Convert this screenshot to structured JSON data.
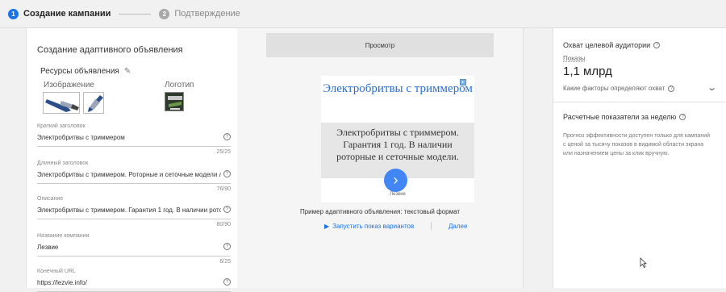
{
  "stepper": {
    "step1_num": "1",
    "step1_label": "Создание кампании",
    "step2_num": "2",
    "step2_label": "Подтверждение"
  },
  "form": {
    "title": "Создание адаптивного объявления",
    "resources_title": "Ресурсы объявления",
    "image_label": "Изображение",
    "logo_label": "Логотип",
    "fields": [
      {
        "label": "Краткий заголовок",
        "value": "Электробритвы с триммером",
        "count": "25/25"
      },
      {
        "label": "Длинный заголовок",
        "value": "Электробритвы с триммером. Роторные и сеточные модели л",
        "count": "76/90"
      },
      {
        "label": "Описание",
        "value": "Электробритвы с триммером. Гарантия 1 год. В наличии ротор",
        "count": "80/90"
      },
      {
        "label": "Название компании",
        "value": "Лезвие",
        "count": "6/25"
      },
      {
        "label": "Конечный URL",
        "value": "https://lezvie.info/",
        "count": ""
      }
    ]
  },
  "preview": {
    "header": "Просмотр",
    "ad_title": "Электробритвы с триммером",
    "ad_description": "Электробритвы с триммером. Гарантия 1 год. В наличии роторные и сеточные модели.",
    "ad_brand": "Лезвие",
    "caption": "Пример адаптивного объявления: текстовый формат",
    "play_label": "Запустить показ вариантов",
    "next_label": "Далее"
  },
  "reach": {
    "title": "Охват целевой аудитории",
    "impressions_label": "Показы",
    "impressions_value": "1,1 млрд",
    "factors_label": "Какие факторы определяют охват",
    "weekly_title": "Расчетные показатели за неделю",
    "weekly_desc": "Прогноз эффективности доступен только для кампаний с ценой за тысячу показов в видимой области экрана или назначением цены за клик вручную."
  },
  "colors": {
    "accent": "#1a73e8",
    "ad_title": "#2a6fd1",
    "cta": "#4285f4"
  }
}
